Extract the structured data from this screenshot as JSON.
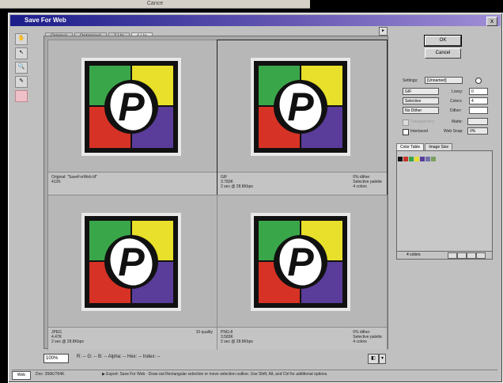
{
  "background_window": {
    "title": "Cance"
  },
  "window": {
    "title": "Save For Web",
    "close_glyph": "x"
  },
  "tabs": [
    "Original",
    "Optimized",
    "2-Up",
    "4-Up"
  ],
  "tab_arrow_glyph": "▸",
  "toolbox": [
    "hand",
    "slice-select",
    "zoom",
    "eyedropper",
    "eyedropper-color"
  ],
  "previews": [
    {
      "left": [
        "Original: \"SaveForWeb.tif\"",
        "412K"
      ],
      "right": [],
      "selected": false
    },
    {
      "left": [
        "GIF",
        "3.783K",
        "2 sec @ 28.8Kbps"
      ],
      "right": [
        "0% dither",
        "Selective palette",
        "4 colors"
      ],
      "selected": true
    },
    {
      "left": [
        "JPEG",
        "4.47K",
        "2 sec @ 28.8Kbps"
      ],
      "right": [
        "10 quality"
      ],
      "selected": false
    },
    {
      "left": [
        "PNG-8",
        "3.583K",
        "2 sec @ 28.8Kbps"
      ],
      "right": [
        "0% dither",
        "Selective palette",
        "4 colors"
      ],
      "selected": false
    }
  ],
  "logo_colors": {
    "green": "#3aa64a",
    "yellow": "#e8e02a",
    "red": "#d63226",
    "purple": "#5a3c9a",
    "letter": "P"
  },
  "bottom": {
    "zoom": "100%",
    "readout": "R: --  G: --  B: --  Alpha: --  Hex: --  Index: --"
  },
  "status": {
    "left": "Web",
    "mid": "Doc: 356K/764K",
    "hint": "▶  Export: Save For Web  ·  Draw out Rectangular selection or move selection outline. Use Shift, Alt, and Ctrl for additional options."
  },
  "right_panel": {
    "ok": "OK",
    "cancel": "Cancel",
    "settings_label": "Settings:",
    "settings_value": "[Unnamed]",
    "format": "GIF",
    "palette": "Selective",
    "dither_algo": "No Dither",
    "lossy_label": "Lossy:",
    "lossy_value": "0",
    "colors_label": "Colors:",
    "colors_value": "4",
    "dither_label": "Dither:",
    "transparency_label": "Transparency",
    "matte_label": "Matte:",
    "interlaced_label": "Interlaced",
    "web_snap_label": "Web Snap:",
    "web_snap_value": "0%",
    "color_tabs": [
      "Color Table",
      "Image Size"
    ],
    "swatches": [
      "#111111",
      "#c83228",
      "#3aa64a",
      "#e6de30",
      "#5a3c9a",
      "#7070a8",
      "#7aa060"
    ],
    "color_count": "4 colors"
  }
}
